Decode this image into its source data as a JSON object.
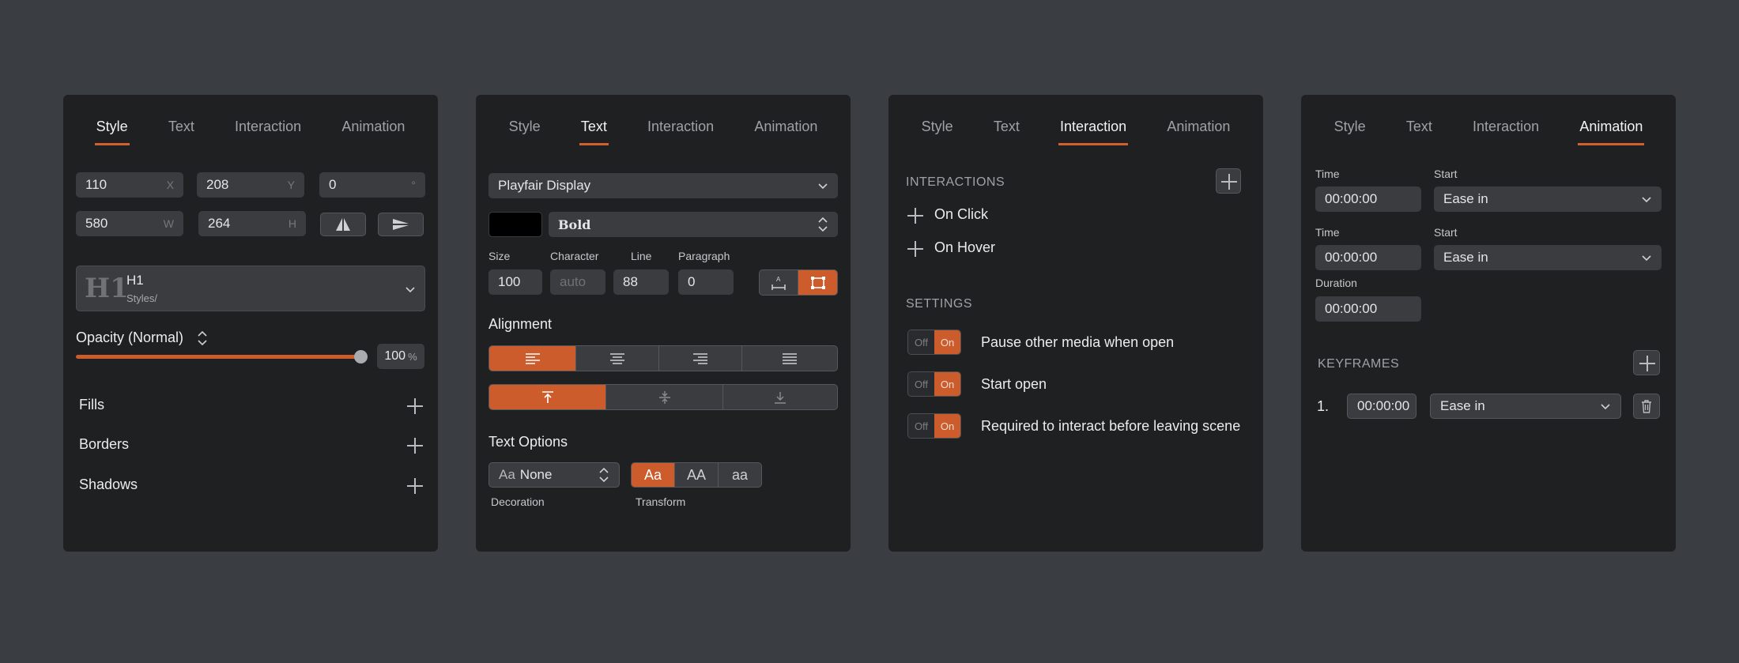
{
  "tabs": [
    "Style",
    "Text",
    "Interaction",
    "Animation"
  ],
  "style_panel": {
    "x": "110",
    "x_label": "X",
    "y": "208",
    "y_label": "Y",
    "rotation": "0",
    "rotation_label": "°",
    "w": "580",
    "w_label": "W",
    "h": "264",
    "h_label": "H",
    "style_title": "H1",
    "style_path": "Styles/",
    "opacity_label": "Opacity (Normal)",
    "opacity_value": "100",
    "opacity_unit": "%",
    "opacity_level": 1.0,
    "fills": "Fills",
    "borders": "Borders",
    "shadows": "Shadows"
  },
  "text_panel": {
    "font": "Playfair Display",
    "weight": "Bold",
    "size_label": "Size",
    "size": "100",
    "character_label": "Character",
    "character_placeholder": "auto",
    "line_label": "Line",
    "line": "88",
    "paragraph_label": "Paragraph",
    "paragraph": "0",
    "alignment_label": "Alignment",
    "text_options_label": "Text Options",
    "decoration_value": "None",
    "decoration_label": "Decoration",
    "transform_label": "Transform",
    "transform_options": [
      "Aa",
      "AA",
      "aa"
    ]
  },
  "interaction_panel": {
    "interactions_label": "INTERACTIONS",
    "on_click": "On Click",
    "on_hover": "On Hover",
    "settings_label": "SETTINGS",
    "toggle_off": "Off",
    "toggle_on": "On",
    "settings": [
      "Pause other media when open",
      "Start open",
      "Required to interact before leaving scene"
    ]
  },
  "animation_panel": {
    "time_label": "Time",
    "start_label": "Start",
    "duration_label": "Duration",
    "time_1": "00:00:00",
    "start_1": "Ease in",
    "time_2": "00:00:00",
    "start_2": "Ease in",
    "duration": "00:00:00",
    "keyframes_label": "KEYFRAMES",
    "keyframe_index": "1.",
    "keyframe_time": "00:00:00",
    "keyframe_ease": "Ease in"
  },
  "colors": {
    "accent": "#cc5c2c",
    "panel": "#1f2022",
    "background": "#3a3d42",
    "field": "#3b3c40",
    "text_color_swatch": "#000000"
  }
}
